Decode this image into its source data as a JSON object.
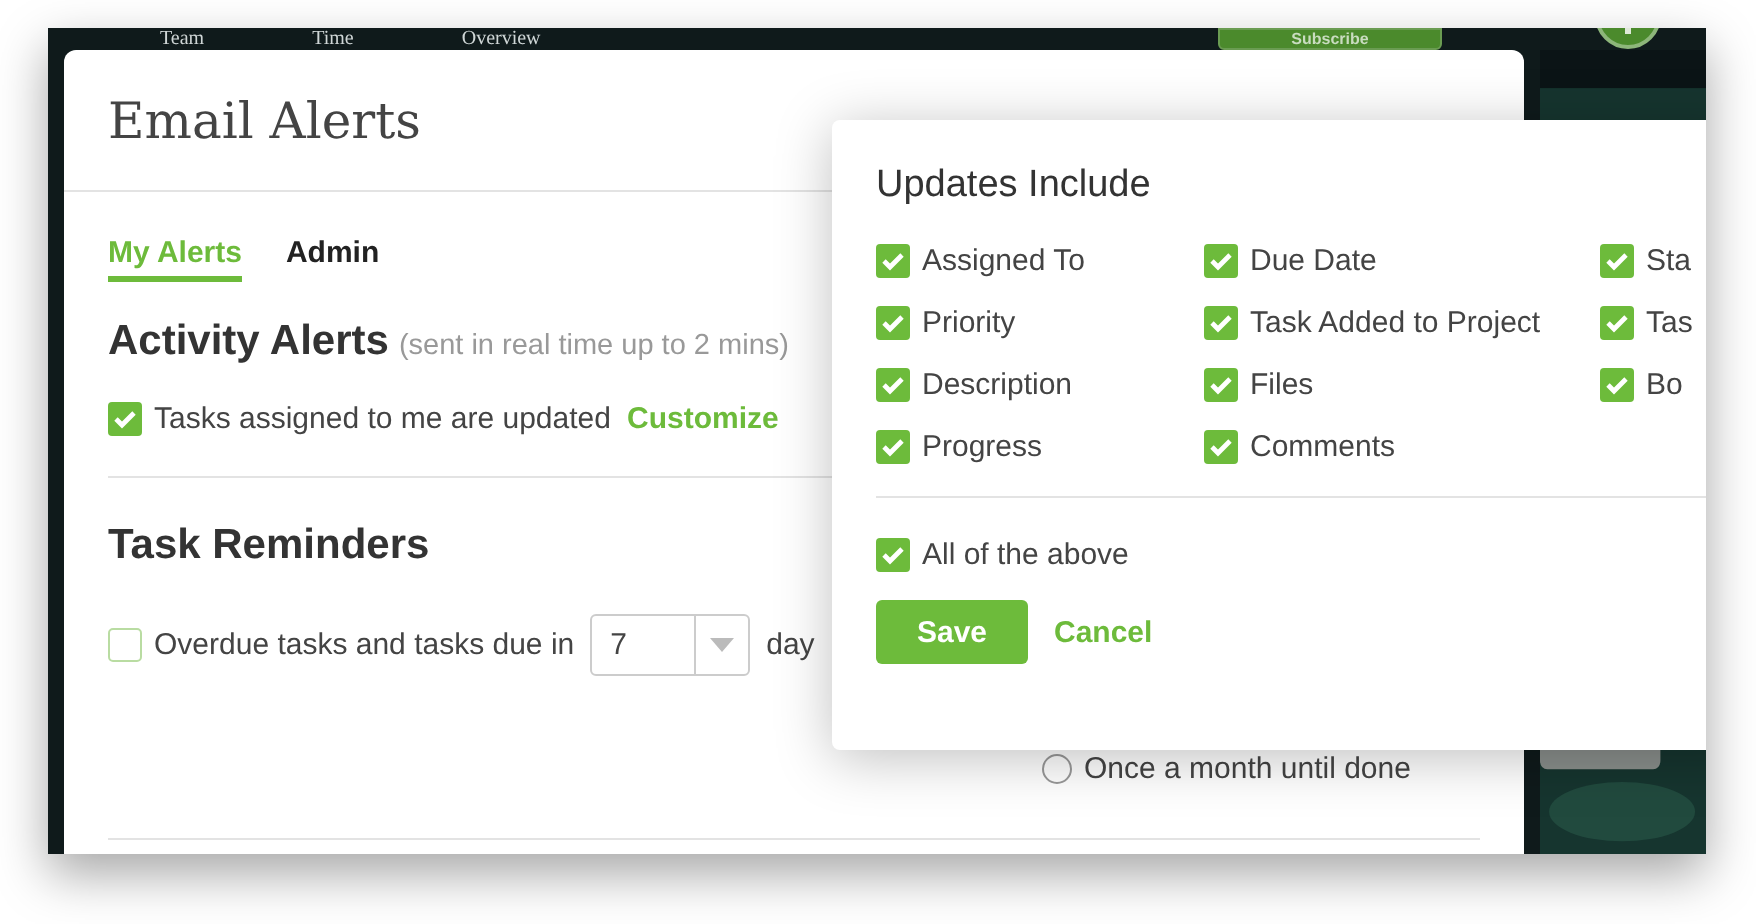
{
  "background_nav": {
    "items": [
      "Team",
      "Time",
      "Overview"
    ],
    "subscribe_button": "Subscribe"
  },
  "dialog": {
    "title": "Email Alerts",
    "tabs": [
      {
        "label": "My Alerts",
        "selected": true
      },
      {
        "label": "Admin",
        "selected": false
      }
    ],
    "activity": {
      "heading": "Activity Alerts",
      "note": "(sent in real time up to 2 mins)",
      "option": {
        "label": "Tasks assigned to me are updated",
        "checked": true
      },
      "customize_link": "Customize"
    },
    "reminders": {
      "heading": "Task Reminders",
      "option": {
        "label": "Overdue tasks and tasks due in",
        "checked": false
      },
      "days_select": {
        "value": "7"
      },
      "suffix": "day",
      "frequency": [
        {
          "label": "Once a month until done",
          "selected": false
        }
      ]
    }
  },
  "popover": {
    "title": "Updates Include",
    "columns": [
      {
        "items": [
          {
            "label": "Assigned To",
            "checked": true
          },
          {
            "label": "Priority",
            "checked": true
          },
          {
            "label": "Description",
            "checked": true
          },
          {
            "label": "Progress",
            "checked": true
          }
        ]
      },
      {
        "items": [
          {
            "label": "Due Date",
            "checked": true
          },
          {
            "label": "Task Added to Project",
            "checked": true
          },
          {
            "label": "Files",
            "checked": true
          },
          {
            "label": "Comments",
            "checked": true
          }
        ]
      },
      {
        "items": [
          {
            "label": "Sta",
            "checked": true
          },
          {
            "label": "Tas",
            "checked": true
          },
          {
            "label": "Bo",
            "checked": true
          }
        ]
      }
    ],
    "all": {
      "label": "All of the above",
      "checked": true
    },
    "buttons": [
      {
        "kind": "primary",
        "label": "Save"
      },
      {
        "kind": "link",
        "label": "Cancel"
      }
    ]
  }
}
